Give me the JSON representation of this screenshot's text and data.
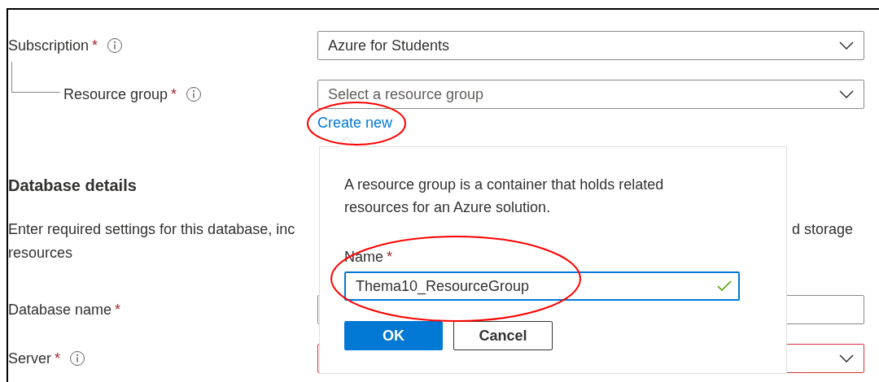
{
  "project": {
    "subscription": {
      "label": "Subscription",
      "required": "*",
      "value": "Azure for Students"
    },
    "resource_group": {
      "label": "Resource group",
      "required": "*",
      "placeholder": "Select a resource group",
      "link": "Create new"
    }
  },
  "database_details": {
    "heading": "Database details",
    "description_left": "Enter required settings for this database, inc",
    "description_right": "d storage",
    "description_line_2": "resources",
    "database_name": {
      "label": "Database name",
      "required": "*"
    },
    "server": {
      "label": "Server",
      "required": "*",
      "invalid": true
    }
  },
  "popup": {
    "text": "A resource group is a container that holds related resources for an Azure solution.",
    "name_label": "Name",
    "required": "*",
    "name_value": "Thema10_ResourceGroup",
    "valid": true,
    "buttons": [
      {
        "label": "OK",
        "kind": "primary"
      },
      {
        "label": "Cancel",
        "kind": "secondary"
      }
    ]
  }
}
